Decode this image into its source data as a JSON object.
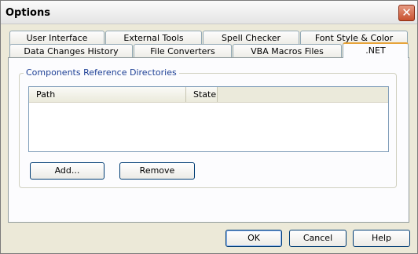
{
  "window": {
    "title": "Options"
  },
  "titlebar": {
    "close_glyph": "✕",
    "close_icon": "close-icon"
  },
  "tabs_row1": [
    "User Interface",
    "External Tools",
    "Spell Checker",
    "Font Style & Color"
  ],
  "tabs_row2": [
    "Data Changes History",
    "File Converters",
    "VBA Macros Files",
    ".NET"
  ],
  "active_tab": ".NET",
  "group": {
    "label": "Components Reference Directories"
  },
  "list": {
    "columns": [
      "Path",
      "State"
    ],
    "rows": []
  },
  "buttons": {
    "add": "Add...",
    "remove": "Remove"
  },
  "dialog_buttons": {
    "ok": "OK",
    "cancel": "Cancel",
    "help": "Help"
  }
}
